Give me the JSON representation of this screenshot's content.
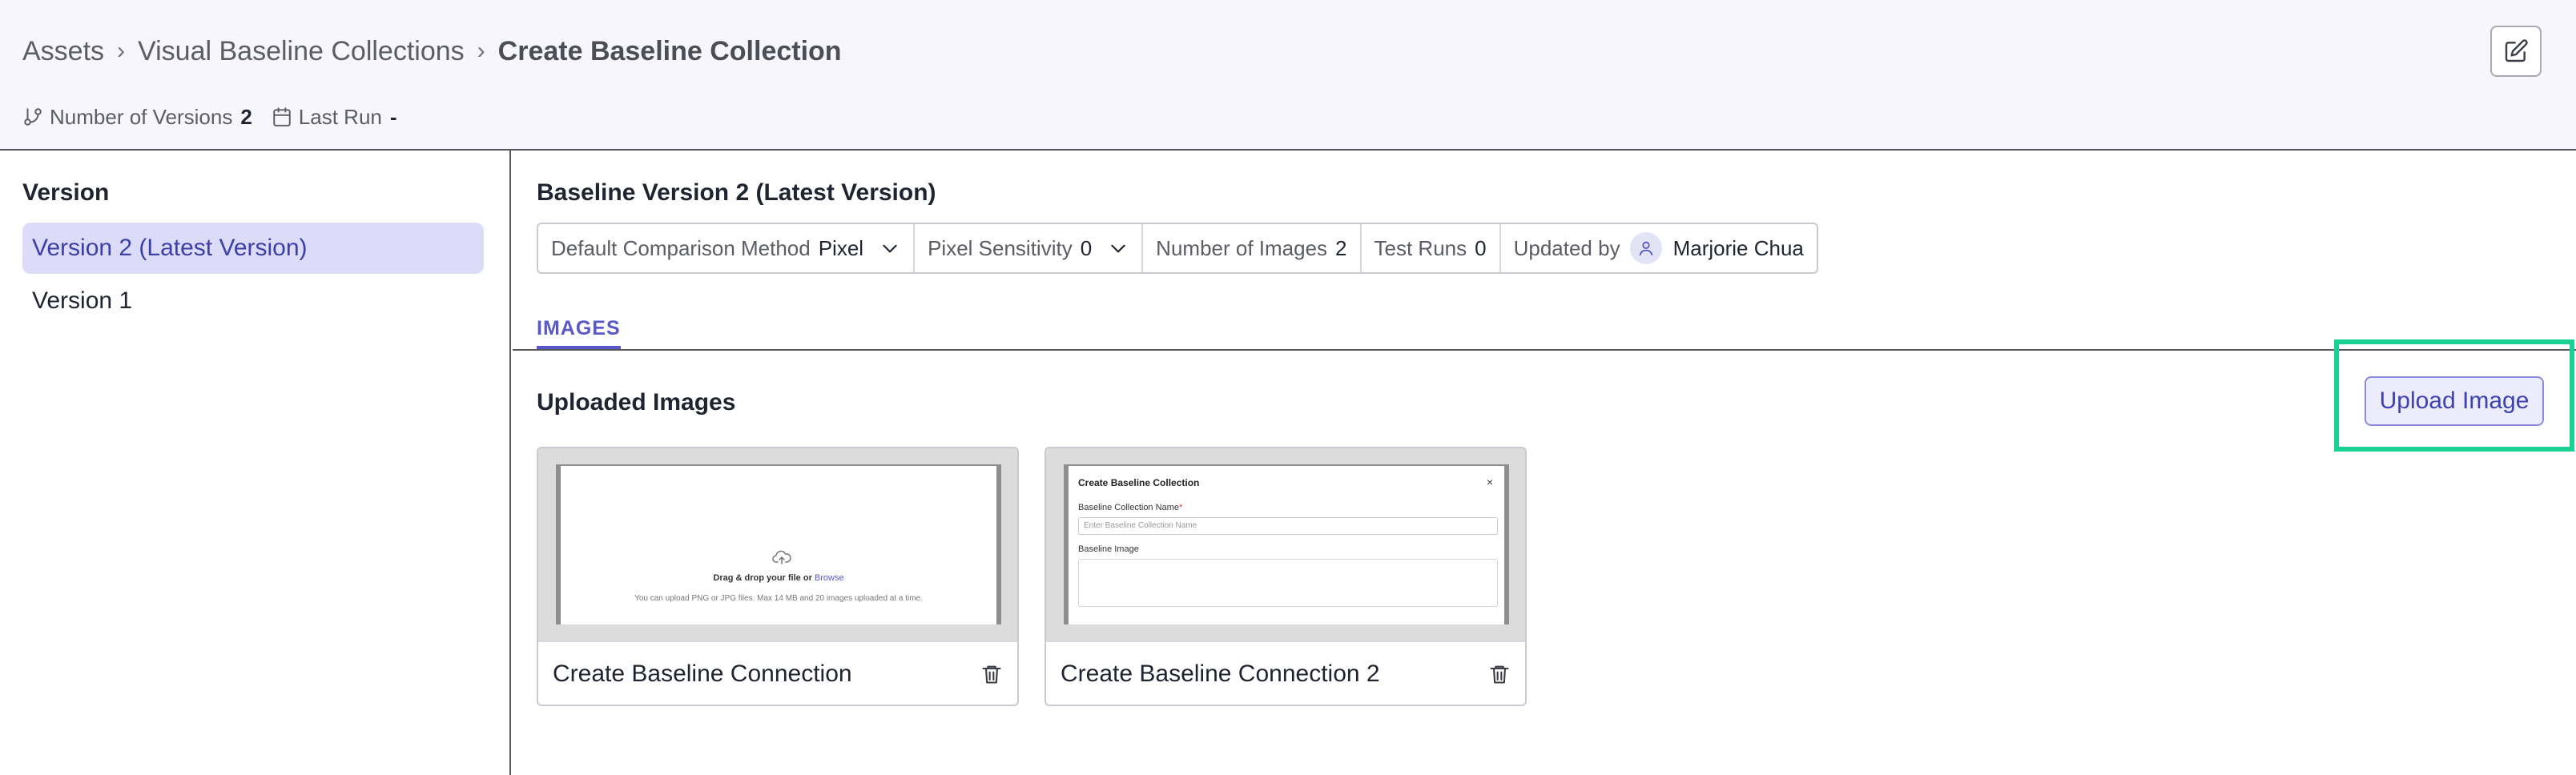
{
  "breadcrumb": {
    "items": [
      "Assets",
      "Visual Baseline Collections"
    ],
    "current": "Create Baseline Collection",
    "separator": "›"
  },
  "meta": {
    "versions_label": "Number of Versions",
    "versions_value": "2",
    "last_run_label": "Last Run",
    "last_run_value": "-"
  },
  "sidebar": {
    "title": "Version",
    "items": [
      {
        "label": "Version 2 (Latest Version)",
        "active": true
      },
      {
        "label": "Version 1",
        "active": false
      }
    ]
  },
  "main": {
    "title": "Baseline Version 2 (Latest Version)",
    "props": {
      "comparison_label": "Default Comparison Method",
      "comparison_value": "Pixel",
      "sensitivity_label": "Pixel Sensitivity",
      "sensitivity_value": "0",
      "images_label": "Number of Images",
      "images_value": "2",
      "runs_label": "Test Runs",
      "runs_value": "0",
      "updated_label": "Updated by",
      "updated_value": "Marjorie Chua"
    },
    "tab": "IMAGES",
    "uploaded_title": "Uploaded Images",
    "upload_button": "Upload Image",
    "cards": [
      {
        "name": "Create Baseline Connection",
        "thumb": {
          "drop_text": "Drag & drop your file or",
          "browse": "Browse",
          "hint": "You can upload PNG or JPG files. Max 14 MB and 20 images uploaded at a time."
        }
      },
      {
        "name": "Create Baseline Connection 2",
        "thumb": {
          "title": "Create Baseline Collection",
          "close": "×",
          "name_label": "Baseline Collection Name",
          "required": "*",
          "name_placeholder": "Enter Baseline Collection Name",
          "image_label": "Baseline Image"
        }
      }
    ]
  },
  "colors": {
    "accent": "#5a57c8",
    "highlight": "#19d194",
    "active_bg": "#dcdcf9"
  }
}
